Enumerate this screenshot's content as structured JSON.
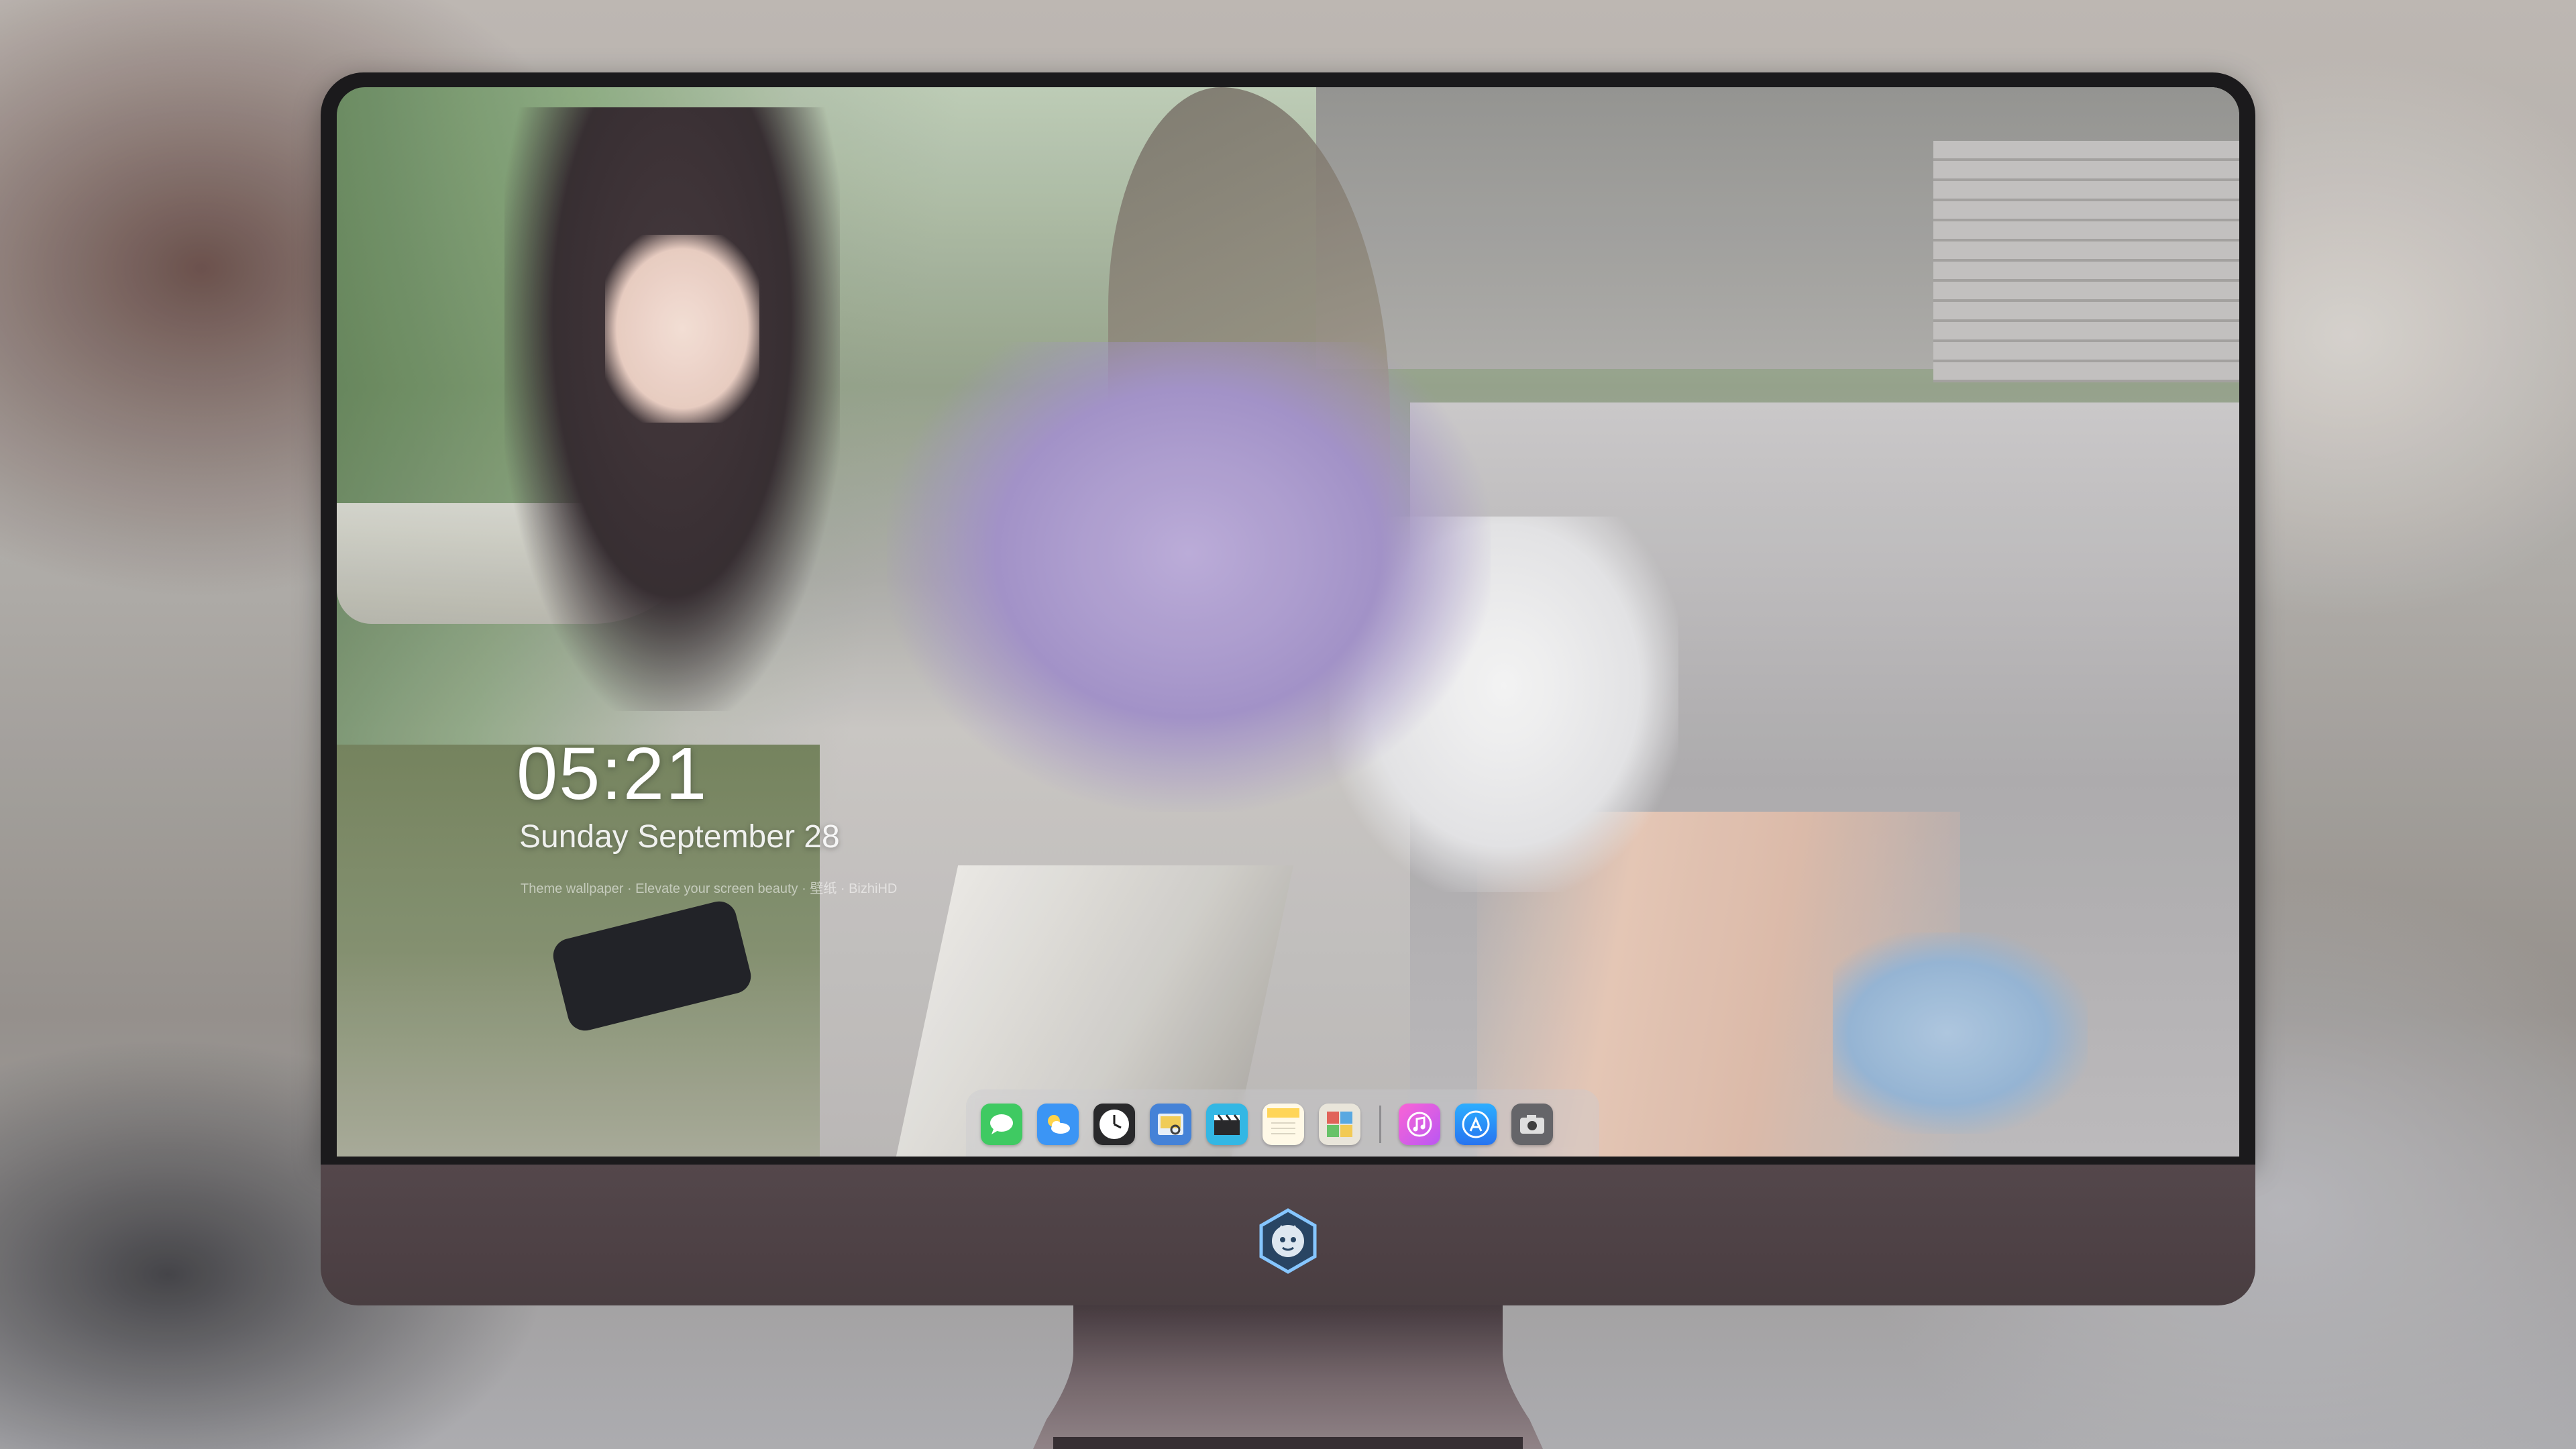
{
  "lock_screen": {
    "time": "05:21",
    "date": "Sunday September 28",
    "caption": "Theme wallpaper · Elevate your screen beauty · 壁纸 · BizhiHD"
  },
  "dock": {
    "apps": [
      {
        "name": "Messages",
        "icon": "messages-icon",
        "color": "#34c759"
      },
      {
        "name": "Weather",
        "icon": "weather-icon",
        "color": "#2f8ff5"
      },
      {
        "name": "Clock",
        "icon": "clock-icon",
        "color": "#1c1c1e"
      },
      {
        "name": "Preview",
        "icon": "preview-icon",
        "color": "#3a7bd5"
      },
      {
        "name": "Clips",
        "icon": "clips-icon",
        "color": "#27b3e3"
      },
      {
        "name": "Notes",
        "icon": "notes-icon",
        "color": "#ffd34e"
      },
      {
        "name": "Photo Booth",
        "icon": "photo-booth-icon",
        "color": "#e8e4d8"
      },
      {
        "name": "iTunes",
        "icon": "music-icon",
        "color": "#e94bd9"
      },
      {
        "name": "App Store",
        "icon": "app-store-icon",
        "color": "#1a8cff"
      },
      {
        "name": "Camera",
        "icon": "camera-icon",
        "color": "#5c5c60"
      }
    ]
  },
  "colors": {
    "bezel": "#0d0c0e",
    "chin": "#4a3c40",
    "stand": "#6b5c61"
  }
}
